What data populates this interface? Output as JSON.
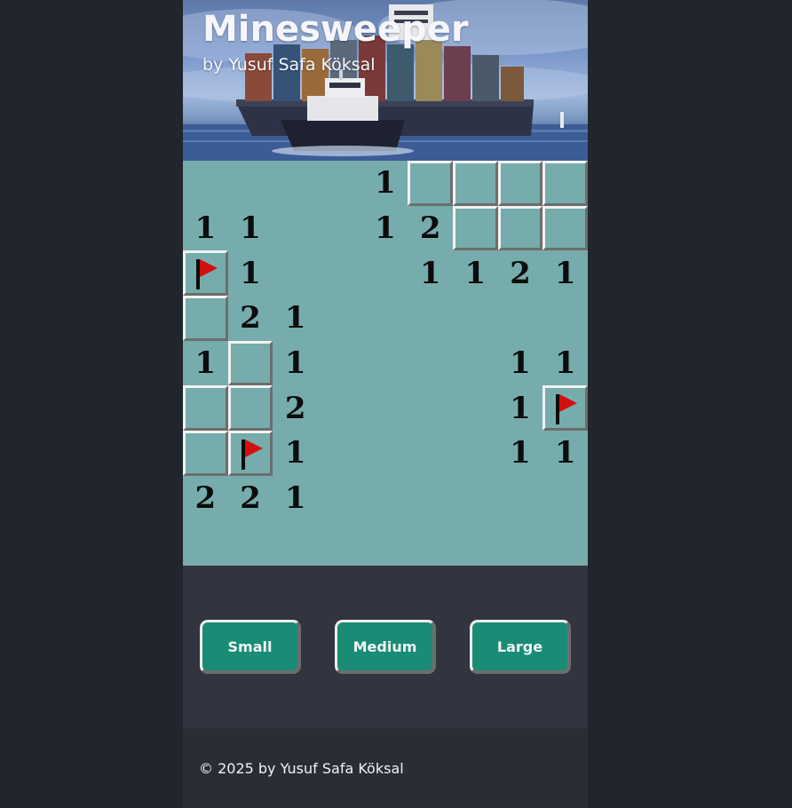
{
  "header": {
    "title": "Minesweeper",
    "subtitle": "by Yusuf Safa Köksal"
  },
  "board": {
    "rows": 9,
    "cols": 9,
    "grid": [
      [
        "",
        "",
        "",
        "",
        "1",
        "#",
        "#",
        "#",
        "#"
      ],
      [
        "1",
        "1",
        "",
        "",
        "1",
        "2",
        "#",
        "#",
        "#"
      ],
      [
        "F",
        "1",
        "",
        "",
        "",
        "1",
        "1",
        "2",
        "1"
      ],
      [
        "#",
        "2",
        "1",
        "",
        "",
        "",
        "",
        "",
        ""
      ],
      [
        "1",
        "#",
        "1",
        "",
        "",
        "",
        "",
        "1",
        "1"
      ],
      [
        "#",
        "#",
        "2",
        "",
        "",
        "",
        "",
        "1",
        "F"
      ],
      [
        "#",
        "F",
        "1",
        "",
        "",
        "",
        "",
        "1",
        "1"
      ],
      [
        "2",
        "2",
        "1",
        "",
        "",
        "",
        "",
        "",
        ""
      ],
      [
        "",
        "",
        "",
        "",
        "",
        "",
        "",
        "",
        ""
      ]
    ],
    "legend": {
      "#": "covered",
      "F": "flagged",
      "": "revealed-empty"
    }
  },
  "controls": {
    "small_label": "Small",
    "medium_label": "Medium",
    "large_label": "Large"
  },
  "footer": {
    "copyright": "© 2025 by Yusuf Safa Köksal"
  },
  "colors": {
    "page_background": "#20252e",
    "board_background": "#76acac",
    "controls_background": "#32353f",
    "footer_background": "#2a2d36",
    "button_background": "#1a8c76",
    "flag_color": "#d31010",
    "number_color": "#0c0c0c"
  },
  "icons": {
    "flag": "flag-icon"
  }
}
